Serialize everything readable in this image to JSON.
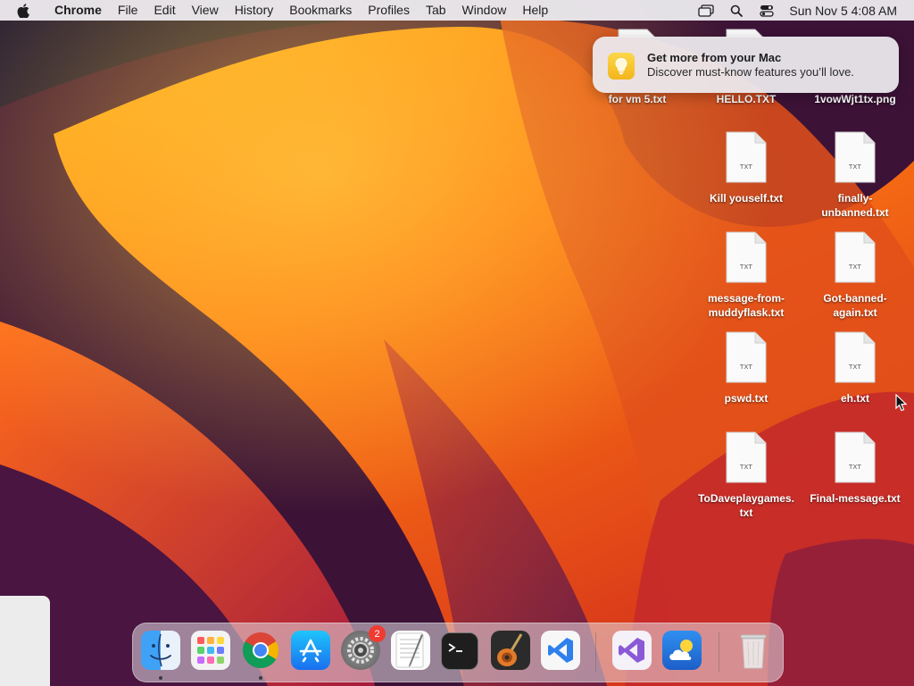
{
  "menubar": {
    "app_name": "Chrome",
    "menus": [
      "File",
      "Edit",
      "View",
      "History",
      "Bookmarks",
      "Profiles",
      "Tab",
      "Window",
      "Help"
    ],
    "clock": "Sun Nov 5  4:08 AM"
  },
  "notification": {
    "title": "Get more from your Mac",
    "body": "Discover must-know features you’ll love."
  },
  "desktop": {
    "partial_labels": [
      "for vm 5.txt",
      "HELLO.TXT",
      "1vowWjt1tx.png"
    ],
    "file_ext": "TXT",
    "files": [
      {
        "label": "Kill youself.txt"
      },
      {
        "label": "finally-\nunbanned.txt"
      },
      {
        "label": "message-from-\nmuddyflask.txt"
      },
      {
        "label": "Got-banned-\nagain.txt"
      },
      {
        "label": "pswd.txt"
      },
      {
        "label": "eh.txt"
      },
      {
        "label": "ToDaveplaygames.\ntxt"
      },
      {
        "label": "Final-message.txt"
      }
    ]
  },
  "dock": {
    "settings_badge": "2",
    "apps": [
      "finder",
      "launchpad",
      "chrome",
      "app-store",
      "system-settings",
      "textedit",
      "terminal",
      "garageband",
      "vscode",
      "visual-studio",
      "weather",
      "trash"
    ]
  },
  "colors": {
    "menubar_bg": "#ECE9ED",
    "badge_red": "#EF3B32",
    "notification_icon": "#F8C630",
    "vscode_blue": "#2F80ED"
  }
}
